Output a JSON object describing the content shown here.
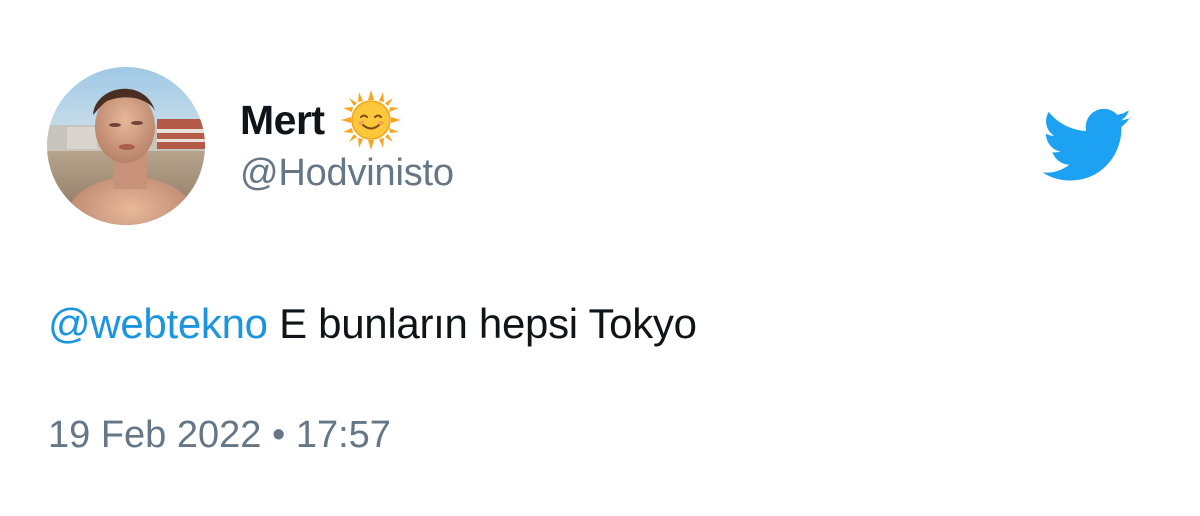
{
  "user": {
    "display_name": "Mert",
    "handle": "@Hodvinisto",
    "name_emoji": "sun-with-face-icon",
    "avatar": "profile-photo"
  },
  "tweet": {
    "mention": "@webtekno",
    "text": " E bunların hepsi Tokyo",
    "date": "19 Feb 2022",
    "separator": " • ",
    "time": "17:57"
  },
  "colors": {
    "twitter_blue": "#1da1f2",
    "mention_blue": "#1b95e0",
    "text_primary": "#0f1419",
    "text_secondary": "#657786"
  },
  "logo": "twitter-bird-icon"
}
